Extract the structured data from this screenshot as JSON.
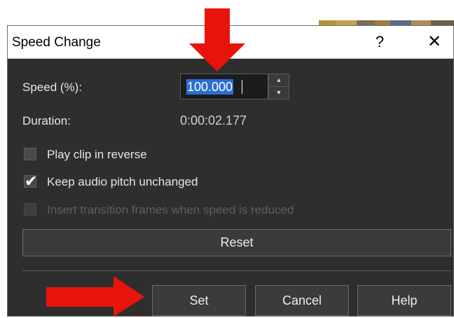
{
  "dialog": {
    "title": "Speed Change",
    "help_glyph": "?",
    "close_glyph": "✕"
  },
  "speed": {
    "label": "Speed (%):",
    "value": "100.000",
    "spin_up_glyph": "▲",
    "spin_down_glyph": "▼"
  },
  "duration": {
    "label": "Duration:",
    "value": "0:00:02.177"
  },
  "options": [
    {
      "label": "Play clip in reverse",
      "checked": false,
      "enabled": true
    },
    {
      "label": "Keep audio pitch unchanged",
      "checked": true,
      "enabled": true
    },
    {
      "label": "Insert transition frames when speed is reduced",
      "checked": false,
      "enabled": false
    }
  ],
  "buttons": {
    "reset": "Reset",
    "set": "Set",
    "cancel": "Cancel",
    "help": "Help"
  },
  "checkmark_glyph": "✔",
  "colors": {
    "dialog_bg": "#2e2e2e",
    "selection": "#2a6fd1",
    "arrow": "#e8140c"
  }
}
